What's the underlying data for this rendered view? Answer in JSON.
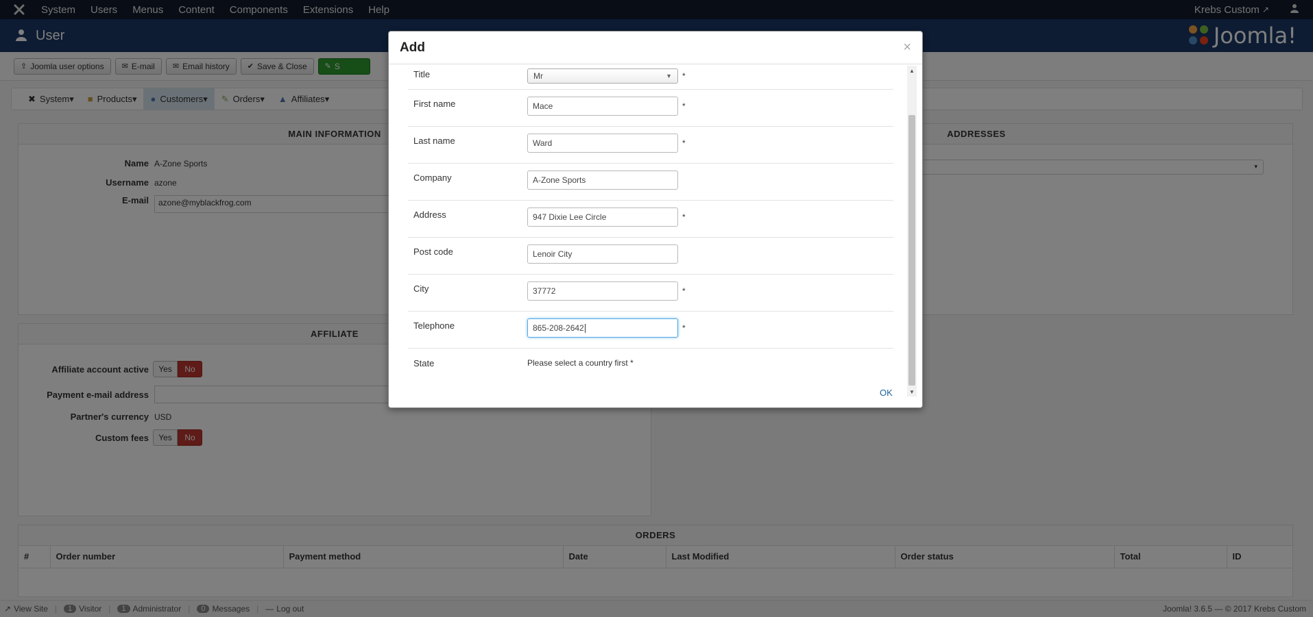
{
  "topnav": {
    "menu": [
      "System",
      "Users",
      "Menus",
      "Content",
      "Components",
      "Extensions",
      "Help"
    ],
    "site_name": "Krebs Custom"
  },
  "header": {
    "title": "User",
    "brand": "Joomla!"
  },
  "toolbar": {
    "buttons": [
      "Joomla user options",
      "E-mail",
      "Email history",
      "Save & Close"
    ],
    "green_button": "S"
  },
  "submenu": {
    "items": [
      "System",
      "Products",
      "Customers",
      "Orders",
      "Affiliates"
    ]
  },
  "main_info": {
    "heading": "MAIN INFORMATION",
    "name_label": "Name",
    "name_value": "A-Zone Sports",
    "username_label": "Username",
    "username_value": "azone",
    "email_label": "E-mail",
    "email_value": "azone@myblackfrog.com"
  },
  "addresses": {
    "heading": "ADDRESSES"
  },
  "affiliate": {
    "heading": "AFFILIATE",
    "active_label": "Affiliate account active",
    "payment_email_label": "Payment e-mail address",
    "currency_label": "Partner's currency",
    "currency_value": "USD",
    "custom_fees_label": "Custom fees",
    "yes": "Yes",
    "no": "No"
  },
  "orders": {
    "heading": "ORDERS",
    "columns": [
      "#",
      "Order number",
      "Payment method",
      "Date",
      "Last Modified",
      "Order status",
      "Total",
      "ID"
    ]
  },
  "statusbar": {
    "view_site": "View Site",
    "visitor_count": "1",
    "visitor": "Visitor",
    "admin_count": "1",
    "administrator": "Administrator",
    "messages_count": "0",
    "messages": "Messages",
    "logout": "Log out",
    "version": "Joomla! 3.6.5 — © 2017 Krebs Custom"
  },
  "modal": {
    "title": "Add",
    "close": "×",
    "ok": "OK",
    "fields": {
      "title_label": "Title",
      "title_value": "Mr",
      "first_name_label": "First name",
      "first_name_value": "Mace",
      "last_name_label": "Last name",
      "last_name_value": "Ward",
      "company_label": "Company",
      "company_value": "A-Zone Sports",
      "address_label": "Address",
      "address_value": "947 Dixie Lee Circle",
      "postcode_label": "Post code",
      "postcode_value": "Lenoir City",
      "city_label": "City",
      "city_value": "37772",
      "telephone_label": "Telephone",
      "telephone_value": "865-208-2642",
      "state_label": "State",
      "state_value": "Please select a country first *"
    },
    "required_mark": "*"
  }
}
